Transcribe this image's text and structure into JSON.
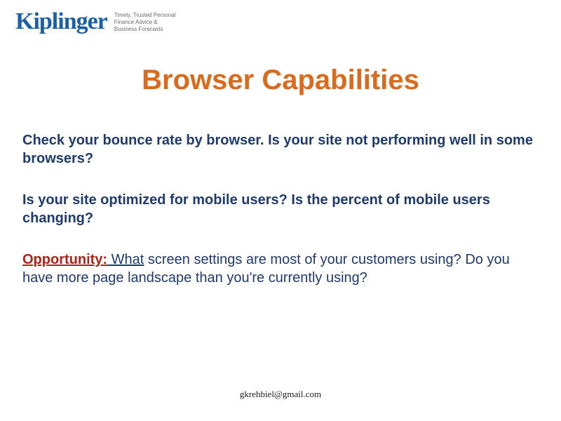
{
  "logo": {
    "word": "Kiplinger",
    "tagline": "Timely, Trusted Personal Finance Advice & Business Forecasts"
  },
  "title": "Browser Capabilities",
  "paragraphs": {
    "p1": "Check your bounce rate by browser. Is your site not performing well in some browsers?",
    "p2": "Is your site optimized for mobile users? Is the percent of mobile users changing?",
    "p3_label": "Opportunity:",
    "p3_rest_underlined": " What",
    "p3_rest_plain": " screen settings are most of your customers using? Do you have more page landscape than you're currently using?"
  },
  "footer": "gkrehbiel@gmail.com"
}
